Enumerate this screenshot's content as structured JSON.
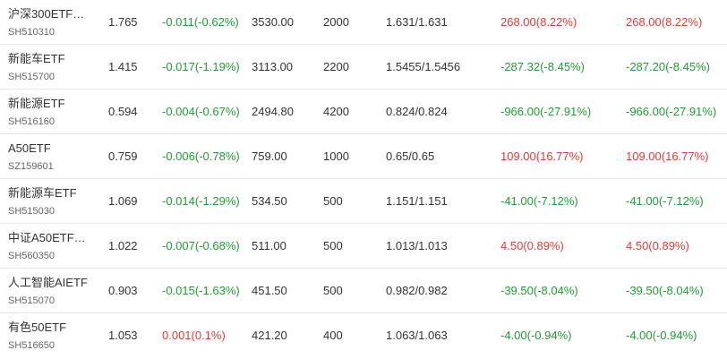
{
  "colors": {
    "up": "#e33b32",
    "down": "#1f9e33",
    "text": "#333333",
    "code": "#666666",
    "divider": "#e8e8e8"
  },
  "rows": [
    {
      "name": "沪深300ETF…",
      "code": "SH510310",
      "price": "1.765",
      "change": "-0.011(-0.62%)",
      "change_dir": "down",
      "amount": "3530.00",
      "volume": "2000",
      "cost": "1.631/1.631",
      "pl1": "268.00(8.22%)",
      "pl1_dir": "up",
      "pl2": "268.00(8.22%)",
      "pl2_dir": "up"
    },
    {
      "name": "新能车ETF",
      "code": "SH515700",
      "price": "1.415",
      "change": "-0.017(-1.19%)",
      "change_dir": "down",
      "amount": "3113.00",
      "volume": "2200",
      "cost": "1.5455/1.5456",
      "pl1": "-287.32(-8.45%)",
      "pl1_dir": "down",
      "pl2": "-287.20(-8.45%)",
      "pl2_dir": "down"
    },
    {
      "name": "新能源ETF",
      "code": "SH516160",
      "price": "0.594",
      "change": "-0.004(-0.67%)",
      "change_dir": "down",
      "amount": "2494.80",
      "volume": "4200",
      "cost": "0.824/0.824",
      "pl1": "-966.00(-27.91%)",
      "pl1_dir": "down",
      "pl2": "-966.00(-27.91%)",
      "pl2_dir": "down"
    },
    {
      "name": "A50ETF",
      "code": "SZ159601",
      "price": "0.759",
      "change": "-0.006(-0.78%)",
      "change_dir": "down",
      "amount": "759.00",
      "volume": "1000",
      "cost": "0.65/0.65",
      "pl1": "109.00(16.77%)",
      "pl1_dir": "up",
      "pl2": "109.00(16.77%)",
      "pl2_dir": "up"
    },
    {
      "name": "新能源车ETF",
      "code": "SH515030",
      "price": "1.069",
      "change": "-0.014(-1.29%)",
      "change_dir": "down",
      "amount": "534.50",
      "volume": "500",
      "cost": "1.151/1.151",
      "pl1": "-41.00(-7.12%)",
      "pl1_dir": "down",
      "pl2": "-41.00(-7.12%)",
      "pl2_dir": "down"
    },
    {
      "name": "中证A50ETF…",
      "code": "SH560350",
      "price": "1.022",
      "change": "-0.007(-0.68%)",
      "change_dir": "down",
      "amount": "511.00",
      "volume": "500",
      "cost": "1.013/1.013",
      "pl1": "4.50(0.89%)",
      "pl1_dir": "up",
      "pl2": "4.50(0.89%)",
      "pl2_dir": "up"
    },
    {
      "name": "人工智能AIETF",
      "code": "SH515070",
      "price": "0.903",
      "change": "-0.015(-1.63%)",
      "change_dir": "down",
      "amount": "451.50",
      "volume": "500",
      "cost": "0.982/0.982",
      "pl1": "-39.50(-8.04%)",
      "pl1_dir": "down",
      "pl2": "-39.50(-8.04%)",
      "pl2_dir": "down"
    },
    {
      "name": "有色50ETF",
      "code": "SH516650",
      "price": "1.053",
      "change": "0.001(0.1%)",
      "change_dir": "up",
      "amount": "421.20",
      "volume": "400",
      "cost": "1.063/1.063",
      "pl1": "-4.00(-0.94%)",
      "pl1_dir": "down",
      "pl2": "-4.00(-0.94%)",
      "pl2_dir": "down"
    }
  ]
}
